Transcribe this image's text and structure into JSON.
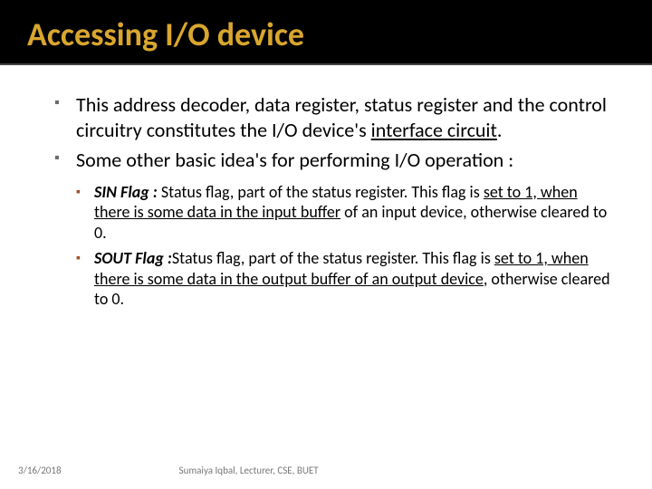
{
  "title": "Accessing I/O device",
  "bullets": [
    {
      "pre": "This address decoder, data register, status register and the control circuitry constitutes the I/O device's ",
      "u": "interface circuit",
      "post": "."
    },
    {
      "pre": " Some other basic idea's for performing I/O operation :",
      "u": "",
      "post": ""
    }
  ],
  "subs": [
    {
      "label": "SIN Flag : ",
      "pre": "Status flag, part of the status register. This flag is ",
      "u": "set to 1, when there is some data in the input buffer",
      "post": " of an input device, otherwise cleared to 0."
    },
    {
      "label": "SOUT Flag :",
      "pre": "Status flag, part of the status register. This flag is ",
      "u": "set to 1, when there is some data in the output buffer of an output device",
      "post": ", otherwise cleared to 0."
    }
  ],
  "footer": {
    "date": "3/16/2018",
    "author": "Sumaiya Iqbal, Lecturer, CSE, BUET"
  }
}
